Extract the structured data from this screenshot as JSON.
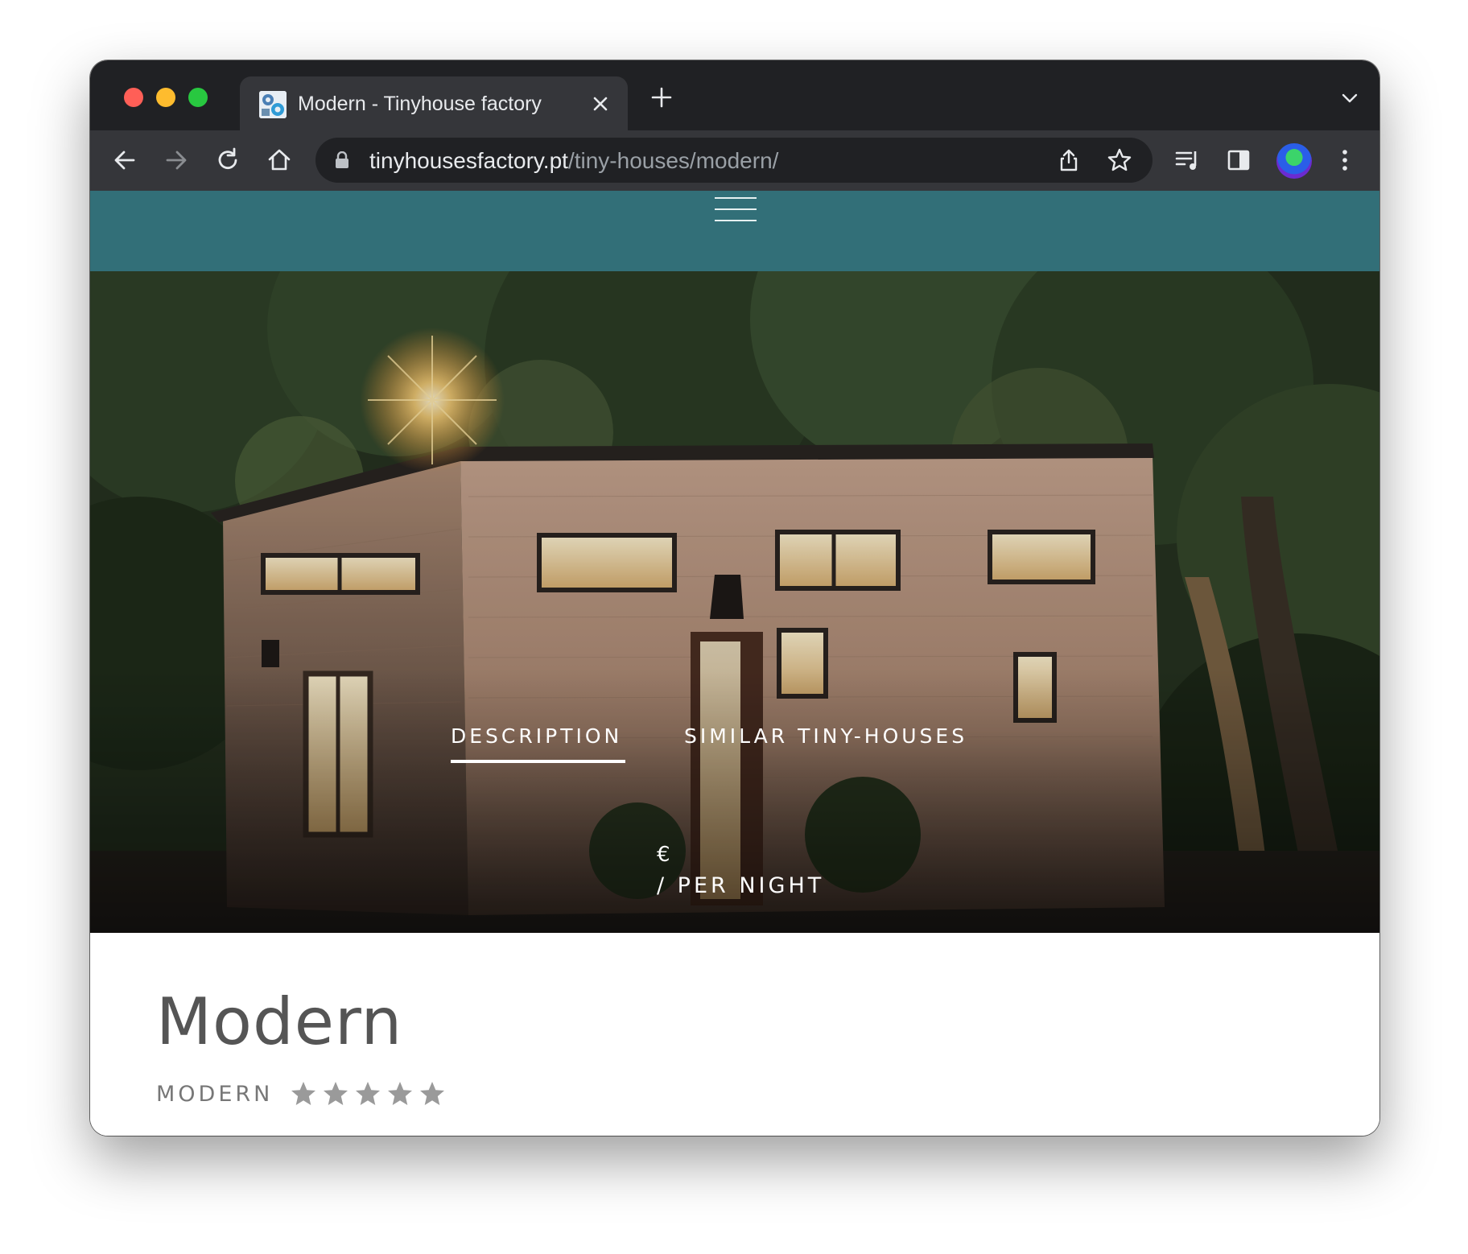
{
  "browser": {
    "tab_title": "Modern - Tinyhouse factory",
    "url_host": "tinyhousesfactory.pt",
    "url_path": "/tiny-houses/modern/"
  },
  "page": {
    "nav_tabs": [
      {
        "label": "DESCRIPTION",
        "active": true
      },
      {
        "label": "SIMILAR TINY-HOUSES",
        "active": false
      }
    ],
    "price": {
      "currency": "€",
      "per_night": "/ PER NIGHT"
    },
    "title": "Modern",
    "category": "MODERN",
    "rating": {
      "value": 5,
      "max": 5
    }
  },
  "colors": {
    "header_bar": "#326f78",
    "chrome_dark": "#202124",
    "chrome_toolbar": "#35363a",
    "star": "#9a9a9a"
  },
  "icons": [
    "tinyhouse-favicon",
    "close-icon",
    "plus-icon",
    "chevron-down-icon",
    "back-arrow-icon",
    "forward-arrow-icon",
    "reload-icon",
    "home-icon",
    "lock-icon",
    "share-icon",
    "bookmark-star-icon",
    "media-controls-icon",
    "side-panel-icon",
    "profile-avatar",
    "kebab-menu-icon",
    "hamburger-menu-icon",
    "rating-star-icon"
  ]
}
